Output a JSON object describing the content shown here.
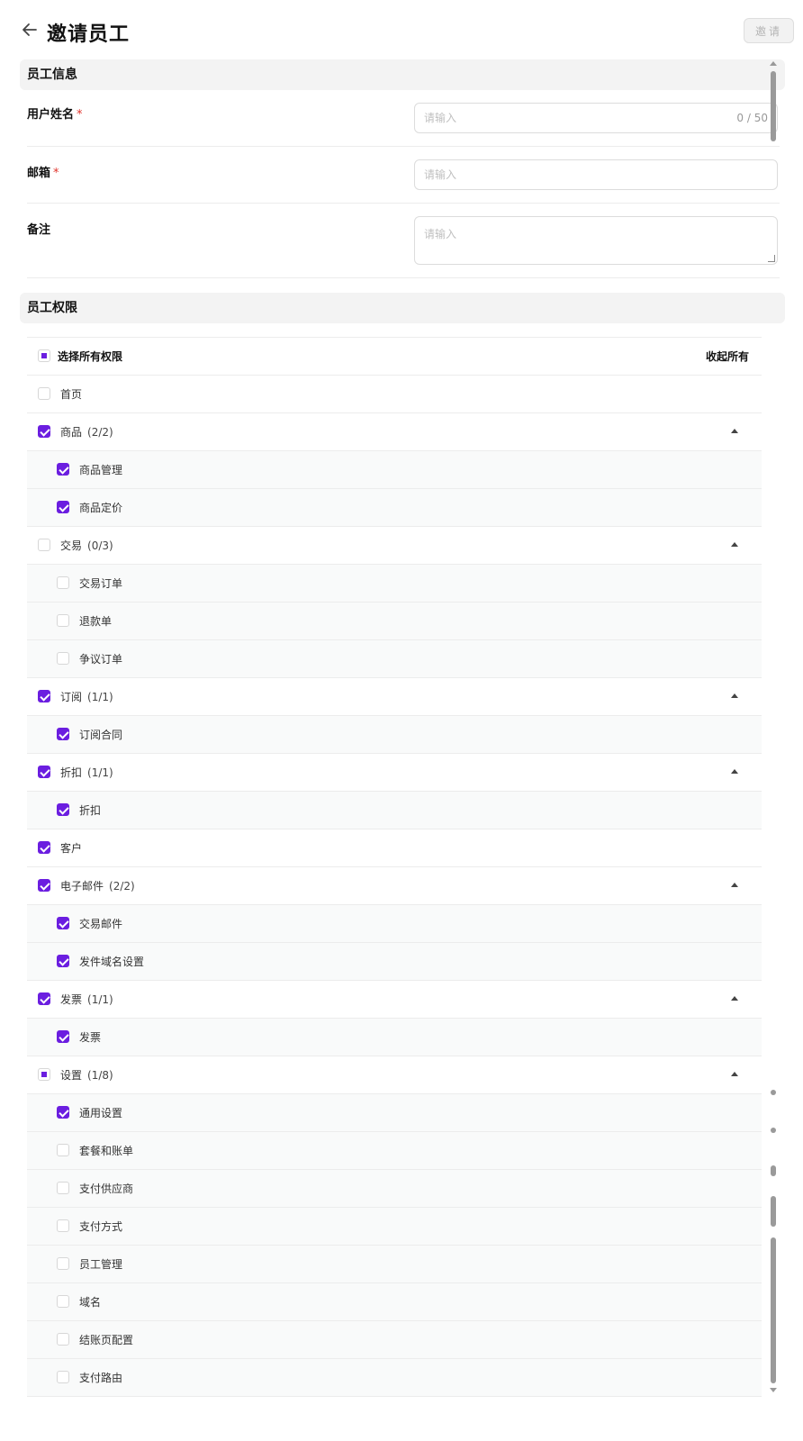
{
  "header": {
    "title": "邀请员工",
    "invite_button": "邀请",
    "back_icon": "arrow-left-icon"
  },
  "employee_info": {
    "section_title": "员工信息",
    "username": {
      "label": "用户姓名",
      "required": true,
      "placeholder": "请输入",
      "counter": "0 / 50"
    },
    "email": {
      "label": "邮箱",
      "required": true,
      "placeholder": "请输入"
    },
    "note": {
      "label": "备注",
      "required": false,
      "placeholder": "请输入"
    }
  },
  "permissions": {
    "section_title": "员工权限",
    "select_all_label": "选择所有权限",
    "collapse_all_label": "收起所有",
    "rows": [
      {
        "level": 0,
        "label": "首页",
        "count": "",
        "state": "unchecked",
        "expandable": false
      },
      {
        "level": 0,
        "label": "商品",
        "count": "(2/2)",
        "state": "checked",
        "expandable": true
      },
      {
        "level": 1,
        "label": "商品管理",
        "count": "",
        "state": "checked",
        "expandable": false
      },
      {
        "level": 1,
        "label": "商品定价",
        "count": "",
        "state": "checked",
        "expandable": false
      },
      {
        "level": 0,
        "label": "交易",
        "count": "(0/3)",
        "state": "unchecked",
        "expandable": true
      },
      {
        "level": 1,
        "label": "交易订单",
        "count": "",
        "state": "unchecked",
        "expandable": false
      },
      {
        "level": 1,
        "label": "退款单",
        "count": "",
        "state": "unchecked",
        "expandable": false
      },
      {
        "level": 1,
        "label": "争议订单",
        "count": "",
        "state": "unchecked",
        "expandable": false
      },
      {
        "level": 0,
        "label": "订阅",
        "count": "(1/1)",
        "state": "checked",
        "expandable": true
      },
      {
        "level": 1,
        "label": "订阅合同",
        "count": "",
        "state": "checked",
        "expandable": false
      },
      {
        "level": 0,
        "label": "折扣",
        "count": "(1/1)",
        "state": "checked",
        "expandable": true
      },
      {
        "level": 1,
        "label": "折扣",
        "count": "",
        "state": "checked",
        "expandable": false
      },
      {
        "level": 0,
        "label": "客户",
        "count": "",
        "state": "checked",
        "expandable": false
      },
      {
        "level": 0,
        "label": "电子邮件",
        "count": "(2/2)",
        "state": "checked",
        "expandable": true
      },
      {
        "level": 1,
        "label": "交易邮件",
        "count": "",
        "state": "checked",
        "expandable": false
      },
      {
        "level": 1,
        "label": "发件域名设置",
        "count": "",
        "state": "checked",
        "expandable": false
      },
      {
        "level": 0,
        "label": "发票",
        "count": "(1/1)",
        "state": "checked",
        "expandable": true
      },
      {
        "level": 1,
        "label": "发票",
        "count": "",
        "state": "checked",
        "expandable": false
      },
      {
        "level": 0,
        "label": "设置",
        "count": "(1/8)",
        "state": "partial",
        "expandable": true
      },
      {
        "level": 1,
        "label": "通用设置",
        "count": "",
        "state": "checked",
        "expandable": false
      },
      {
        "level": 1,
        "label": "套餐和账单",
        "count": "",
        "state": "unchecked",
        "expandable": false
      },
      {
        "level": 1,
        "label": "支付供应商",
        "count": "",
        "state": "unchecked",
        "expandable": false
      },
      {
        "level": 1,
        "label": "支付方式",
        "count": "",
        "state": "unchecked",
        "expandable": false
      },
      {
        "level": 1,
        "label": "员工管理",
        "count": "",
        "state": "unchecked",
        "expandable": false
      },
      {
        "level": 1,
        "label": "域名",
        "count": "",
        "state": "unchecked",
        "expandable": false
      },
      {
        "level": 1,
        "label": "结账页配置",
        "count": "",
        "state": "unchecked",
        "expandable": false
      },
      {
        "level": 1,
        "label": "支付路由",
        "count": "",
        "state": "unchecked",
        "expandable": false
      }
    ]
  },
  "colors": {
    "accent": "#6b1ee0",
    "required": "#e0342c",
    "section_bg": "#f3f3f3",
    "child_row_bg": "#f9fafa"
  }
}
